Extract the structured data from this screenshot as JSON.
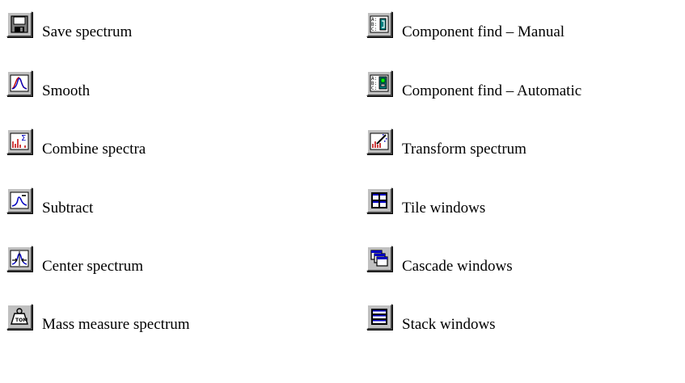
{
  "left_column": [
    {
      "label": "Save spectrum",
      "icon": "floppy-disk-icon"
    },
    {
      "label": "Smooth",
      "icon": "smooth-curve-icon"
    },
    {
      "label": "Combine spectra",
      "icon": "sum-spectra-icon"
    },
    {
      "label": "Subtract",
      "icon": "subtract-peak-icon"
    },
    {
      "label": "Center spectrum",
      "icon": "center-peak-icon"
    },
    {
      "label": "Mass measure spectrum",
      "icon": "weight-icon"
    }
  ],
  "right_column": [
    {
      "label": "Component find – Manual",
      "icon": "component-manual-icon"
    },
    {
      "label": "Component find – Automatic",
      "icon": "component-automatic-icon"
    },
    {
      "label": "Transform spectrum",
      "icon": "transform-wand-icon"
    },
    {
      "label": "Tile windows",
      "icon": "tile-windows-icon"
    },
    {
      "label": "Cascade windows",
      "icon": "cascade-windows-icon"
    },
    {
      "label": "Stack windows",
      "icon": "stack-windows-icon"
    }
  ],
  "colors": {
    "button_face": "#c0c0c0",
    "icon_blue": "#0000c0",
    "icon_red": "#c00000",
    "teal": "#008080"
  }
}
